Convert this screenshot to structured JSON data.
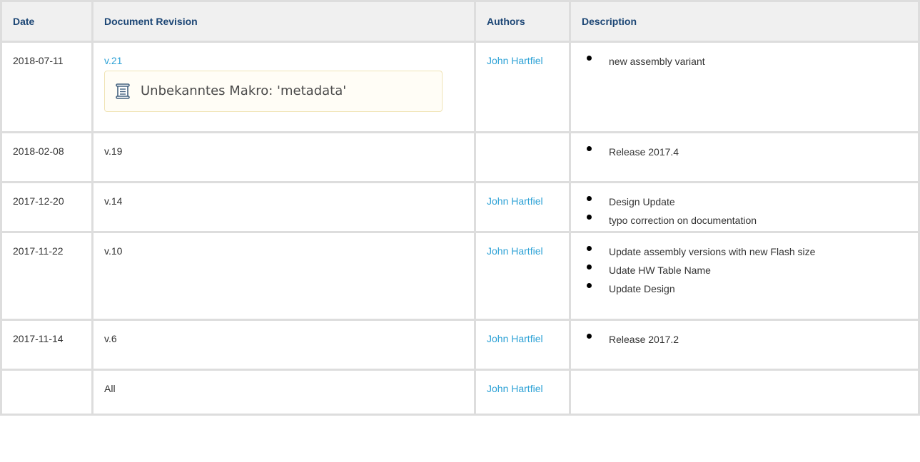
{
  "table": {
    "headers": [
      "Date",
      "Document Revision",
      "Authors",
      "Description"
    ],
    "rows": [
      {
        "date": "2018-07-11",
        "revision": "v.21",
        "revision_link": true,
        "macro": "Unbekanntes Makro: 'metadata'",
        "author": "John Hartfiel",
        "description": [
          "new assembly variant"
        ]
      },
      {
        "date": "2018-02-08",
        "revision": "v.19",
        "revision_link": false,
        "author": "",
        "description": [
          "Release 2017.4"
        ]
      },
      {
        "date": "2017-12-20",
        "revision": "v.14",
        "revision_link": false,
        "author": "John Hartfiel",
        "description": [
          "Design Update",
          "typo correction on documentation"
        ]
      },
      {
        "date": "2017-11-22",
        "revision": "v.10",
        "revision_link": false,
        "author": "John Hartfiel",
        "description": [
          "Update assembly versions with new Flash size",
          "Udate HW Table Name",
          "Update Design"
        ]
      },
      {
        "date": "2017-11-14",
        "revision": "v.6",
        "revision_link": false,
        "author": "John Hartfiel",
        "description": [
          "Release 2017.2"
        ]
      },
      {
        "date": "",
        "revision": "All",
        "revision_link": false,
        "author": "John Hartfiel",
        "description": []
      }
    ]
  },
  "icons": {
    "macro": "scroll-icon",
    "bullet": "bullet-dot"
  },
  "colors": {
    "link": "#2ea2d6",
    "header_text": "#1c4675",
    "header_bg": "#f0f0f0",
    "grid": "#dddddd"
  }
}
